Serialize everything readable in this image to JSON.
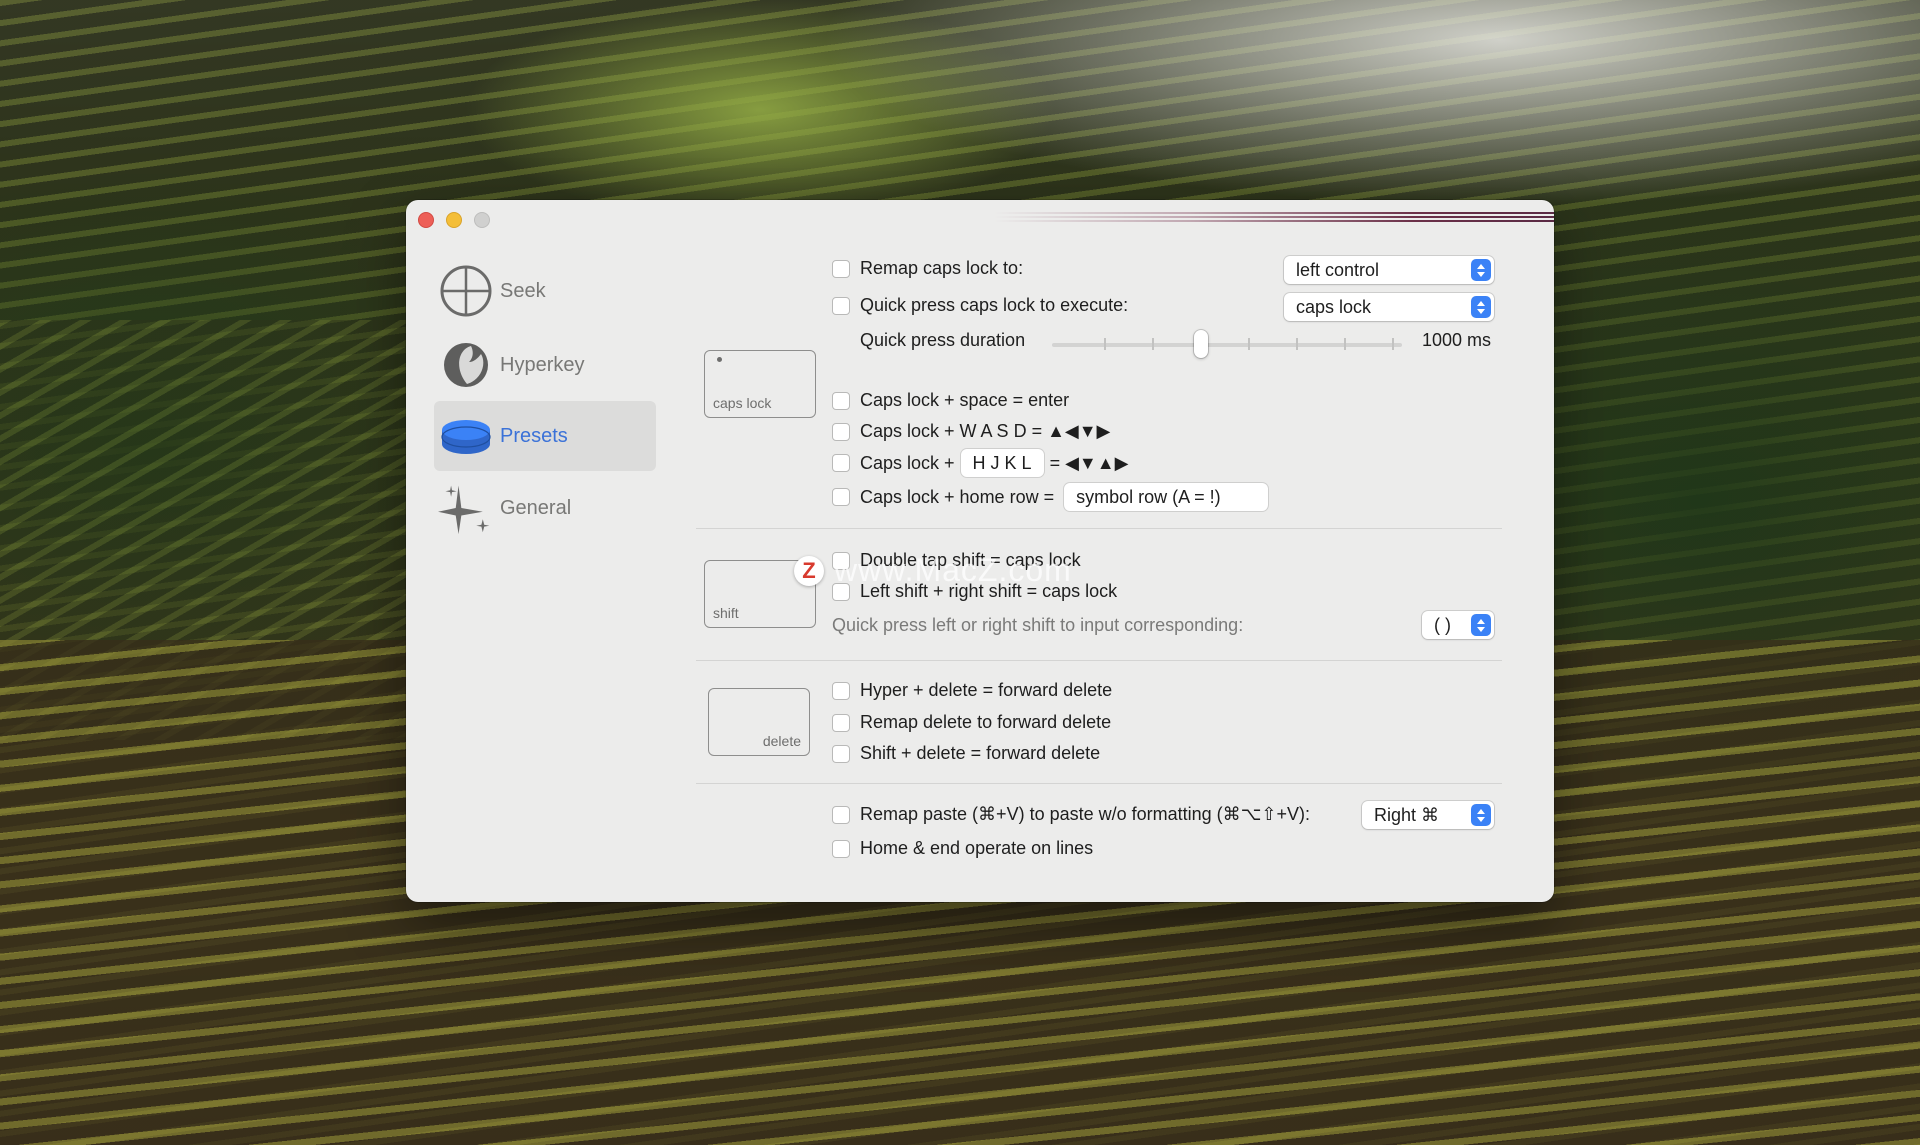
{
  "sidebar": {
    "items": [
      {
        "label": "Seek",
        "icon": "crosshair-icon"
      },
      {
        "label": "Hyperkey",
        "icon": "hyperkey-icon"
      },
      {
        "label": "Presets",
        "icon": "presets-stack-icon",
        "active": true
      },
      {
        "label": "General",
        "icon": "sparkles-icon"
      }
    ]
  },
  "capslock_section": {
    "key_label": "caps lock",
    "remap": {
      "label": "Remap caps lock to:",
      "value": "left control"
    },
    "quick_press": {
      "label": "Quick press caps lock to execute:",
      "value": "caps lock"
    },
    "duration": {
      "label": "Quick press duration",
      "value_text": "1000 ms",
      "position": 0.39
    },
    "space_enter": "Caps lock + space = enter",
    "wasd": "Caps lock + W A S D = ▲◀▼▶",
    "hjkl": {
      "prefix": "Caps lock +",
      "field": "H J K L",
      "suffix": "= ◀▼▲▶"
    },
    "home_row": {
      "label": "Caps lock + home row =",
      "value": "symbol row (A = !)"
    }
  },
  "shift_section": {
    "key_label": "shift",
    "double_tap": "Double tap shift = caps lock",
    "left_right": "Left shift + right shift = caps lock",
    "quick_press": {
      "label": "Quick press left or right shift to input corresponding:",
      "value": "( )"
    }
  },
  "delete_section": {
    "key_label": "delete",
    "hyper_delete": "Hyper + delete = forward delete",
    "remap_delete": "Remap delete to forward delete",
    "shift_delete": "Shift + delete = forward delete"
  },
  "misc_section": {
    "remap_paste": {
      "label": "Remap paste (⌘+V) to paste w/o formatting (⌘⌥⇧+V):",
      "value": "Right ⌘"
    },
    "home_end": "Home & end operate on lines"
  },
  "watermark": {
    "badge": "Z",
    "text": "www.MacZ.com"
  },
  "colors": {
    "accent": "#3b82f6",
    "active_label": "#3b72d8"
  }
}
